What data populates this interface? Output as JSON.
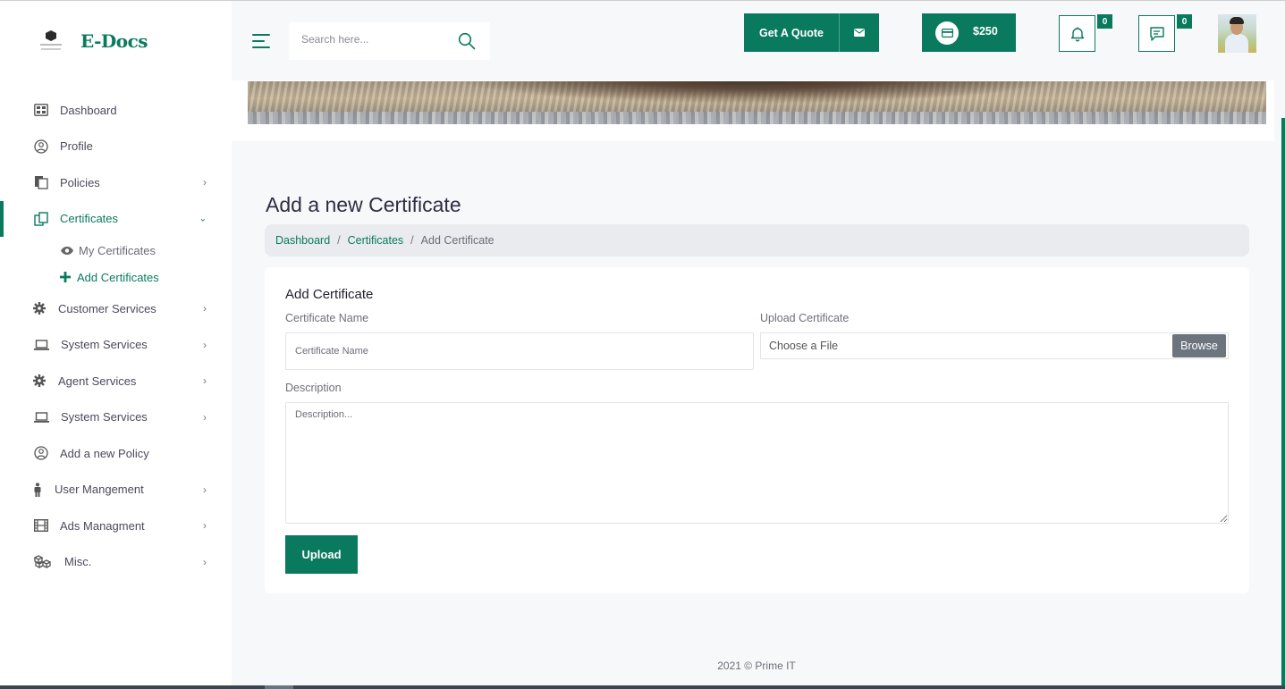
{
  "brand": {
    "name": "E-Docs"
  },
  "sidebar": {
    "items": [
      {
        "label": "Dashboard",
        "icon": "dashboard-icon"
      },
      {
        "label": "Profile",
        "icon": "profile-icon"
      },
      {
        "label": "Policies",
        "icon": "policies-icon"
      },
      {
        "label": "Certificates",
        "icon": "certificates-icon",
        "active": true,
        "expanded": true
      },
      {
        "label": "Customer Services",
        "icon": "gear-icon"
      },
      {
        "label": "System Services",
        "icon": "laptop-icon"
      },
      {
        "label": "Agent Services",
        "icon": "gear-icon"
      },
      {
        "label": "System Services",
        "icon": "laptop-icon"
      },
      {
        "label": "Add a new Policy",
        "icon": "policy-icon"
      },
      {
        "label": "User Mangement",
        "icon": "user-icon"
      },
      {
        "label": "Ads Managment",
        "icon": "film-icon"
      },
      {
        "label": "Misc.",
        "icon": "boxes-icon"
      }
    ],
    "sub_items": [
      {
        "label": "My Certificates",
        "icon": "eye-icon"
      },
      {
        "label": "Add Certificates",
        "icon": "plus-icon",
        "active": true
      }
    ]
  },
  "header": {
    "search_placeholder": "Search here...",
    "quote_label": "Get A Quote",
    "wallet_amount": "$250",
    "notifications_count": "0",
    "messages_count": "0"
  },
  "main": {
    "title": "Add a new Certificate",
    "breadcrumb": [
      "Dashboard",
      "Certificates",
      "Add Certificate"
    ],
    "form": {
      "title": "Add Certificate",
      "name_label": "Certificate Name",
      "name_placeholder": "Certificate Name",
      "upload_label": "Upload Certificate",
      "file_text": "Choose a File",
      "browse_label": "Browse",
      "description_label": "Description",
      "description_placeholder": "Description...",
      "submit_label": "Upload"
    }
  },
  "footer": {
    "text": "2021 © Prime IT"
  },
  "colors": {
    "accent": "#0a7a5f",
    "text": "#3b3b4f",
    "muted": "#6f6f7c",
    "background": "#f7f8f9"
  }
}
